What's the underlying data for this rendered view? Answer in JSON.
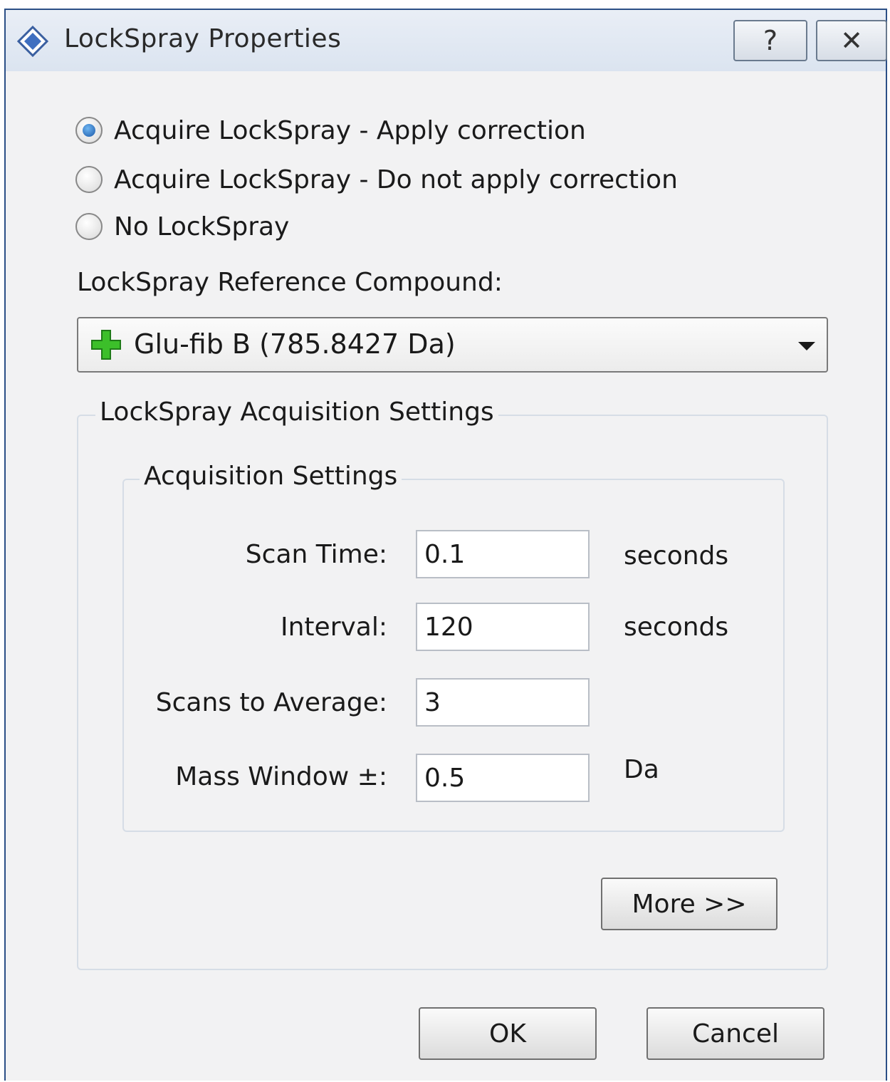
{
  "window": {
    "title": "LockSpray Properties",
    "help_label": "?",
    "close_label": "✕"
  },
  "mode": {
    "options": [
      {
        "label": "Acquire LockSpray - Apply correction",
        "checked": true
      },
      {
        "label": "Acquire LockSpray - Do not apply correction",
        "checked": false
      },
      {
        "label": "No LockSpray",
        "checked": false
      }
    ]
  },
  "reference": {
    "label": "LockSpray Reference Compound:",
    "selected": "Glu-fib B (785.8427 Da)",
    "icon": "green-plus-icon"
  },
  "acquisition": {
    "group_title": "LockSpray Acquisition Settings",
    "subgroup_title": "Acquisition Settings",
    "fields": {
      "scan_time": {
        "label": "Scan Time:",
        "value": "0.1",
        "unit": "seconds"
      },
      "interval": {
        "label": "Interval:",
        "value": "120",
        "unit": "seconds"
      },
      "scans_to_average": {
        "label": "Scans to Average:",
        "value": "3"
      },
      "mass_window": {
        "label": "Mass Window ±:",
        "value": "0.5",
        "unit": "Da"
      }
    },
    "more_label": "More >>"
  },
  "footer": {
    "ok_label": "OK",
    "cancel_label": "Cancel"
  },
  "colors": {
    "accent": "#1a58a8",
    "plus_icon": "#3cbf2a",
    "frame": "#2b4f86"
  }
}
